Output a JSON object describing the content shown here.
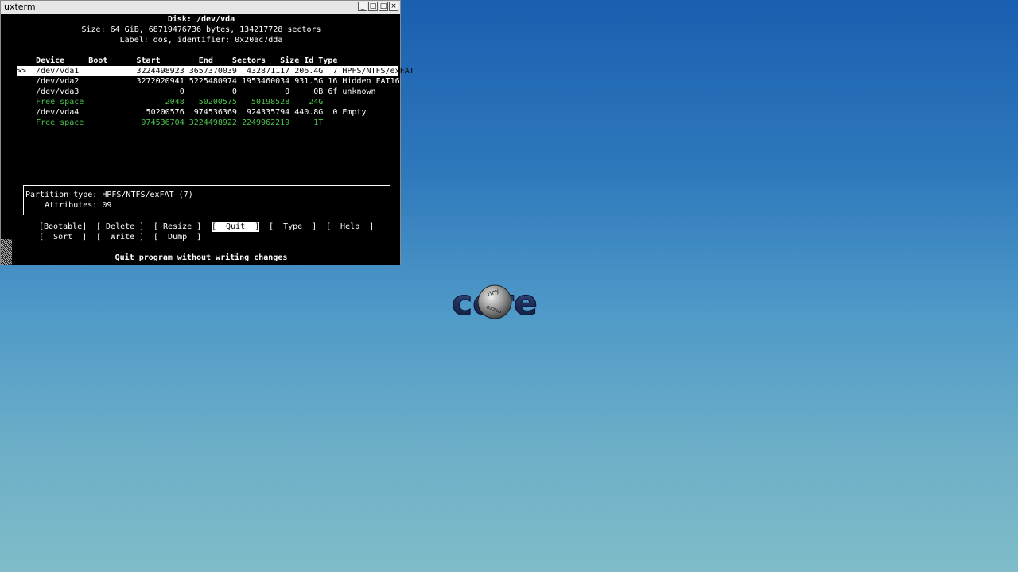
{
  "window": {
    "title": "uxterm",
    "buttons": [
      "_",
      "□",
      "□",
      "×"
    ]
  },
  "terminal": {
    "disk_title": "Disk: /dev/vda",
    "size_line": "Size: 64 GiB, 68719476736 bytes, 134217728 sectors",
    "label_line": "Label: dos, identifier: 0x20ac7dda",
    "header": "    Device     Boot      Start        End    Sectors   Size Id Type",
    "rows": [
      ">>  /dev/vda1            3224498923 3657370039  432871117 206.4G  7 HPFS/NTFS/exFAT",
      "    /dev/vda2            3272020941 5225480974 1953460034 931.5G 16 Hidden FAT16",
      "    /dev/vda3                     0          0          0     0B 6f unknown",
      "    Free space                 2048   50200575   50198528    24G",
      "    /dev/vda4              50200576  974536369  924335794 440.8G  0 Empty",
      "    Free space            974536704 3224498922 2249962219     1T"
    ],
    "info": {
      "line1": "Partition type: HPFS/NTFS/exFAT (7)",
      "line2": "    Attributes: 09"
    },
    "menu_row1": [
      {
        "label": "[Bootable]",
        "selected": false
      },
      {
        "label": "[ Delete ]",
        "selected": false
      },
      {
        "label": "[ Resize ]",
        "selected": false
      },
      {
        "label": "[  Quit  ]",
        "selected": true
      },
      {
        "label": "[  Type  ]",
        "selected": false
      },
      {
        "label": "[  Help  ]",
        "selected": false
      }
    ],
    "menu_row2": [
      {
        "label": "[  Sort  ]",
        "selected": false
      },
      {
        "label": "[  Write ]",
        "selected": false
      },
      {
        "label": "[  Dump  ]",
        "selected": false
      }
    ],
    "status": "Quit program without writing changes"
  },
  "desktop": {
    "logo_text": "core",
    "logo_badge_top": "tiny",
    "logo_badge_bottom": "micro"
  }
}
